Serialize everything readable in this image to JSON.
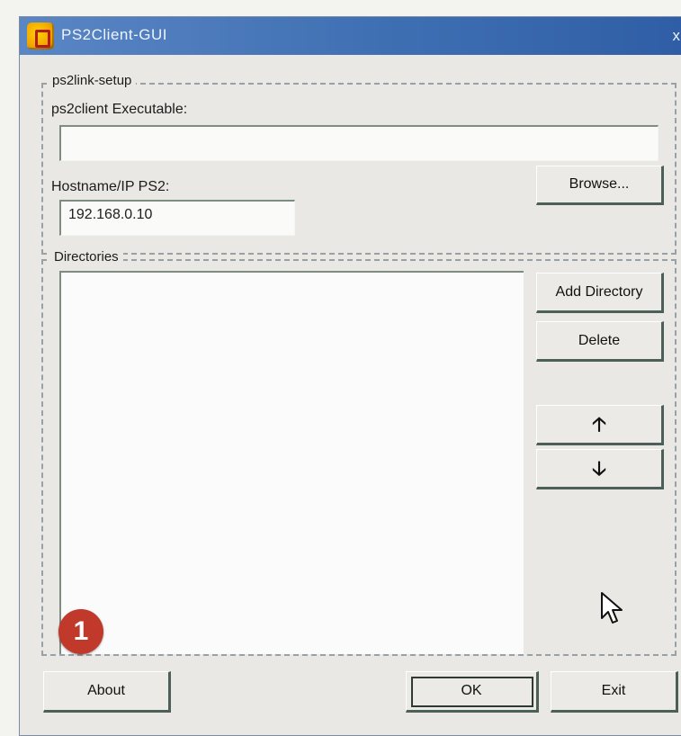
{
  "window": {
    "title": "PS2Client-GUI",
    "close_glyph": "x"
  },
  "setup_group": {
    "legend": "ps2link-setup",
    "executable_label": "ps2client Executable:",
    "executable_value": "",
    "hostname_label": "Hostname/IP PS2:",
    "hostname_value": "192.168.0.10",
    "browse_label": "Browse..."
  },
  "directories_group": {
    "legend": "Directories",
    "items": [],
    "add_label": "Add Directory",
    "delete_label": "Delete",
    "up_label": "🡡",
    "down_label": "🡣"
  },
  "footer": {
    "about_label": "About",
    "ok_label": "OK",
    "exit_label": "Exit"
  },
  "annotation": {
    "badge_number": "1"
  },
  "colors": {
    "titlebar": "#3f6fb3",
    "badge": "#c0392b",
    "window_bg": "#e9e8e4"
  }
}
